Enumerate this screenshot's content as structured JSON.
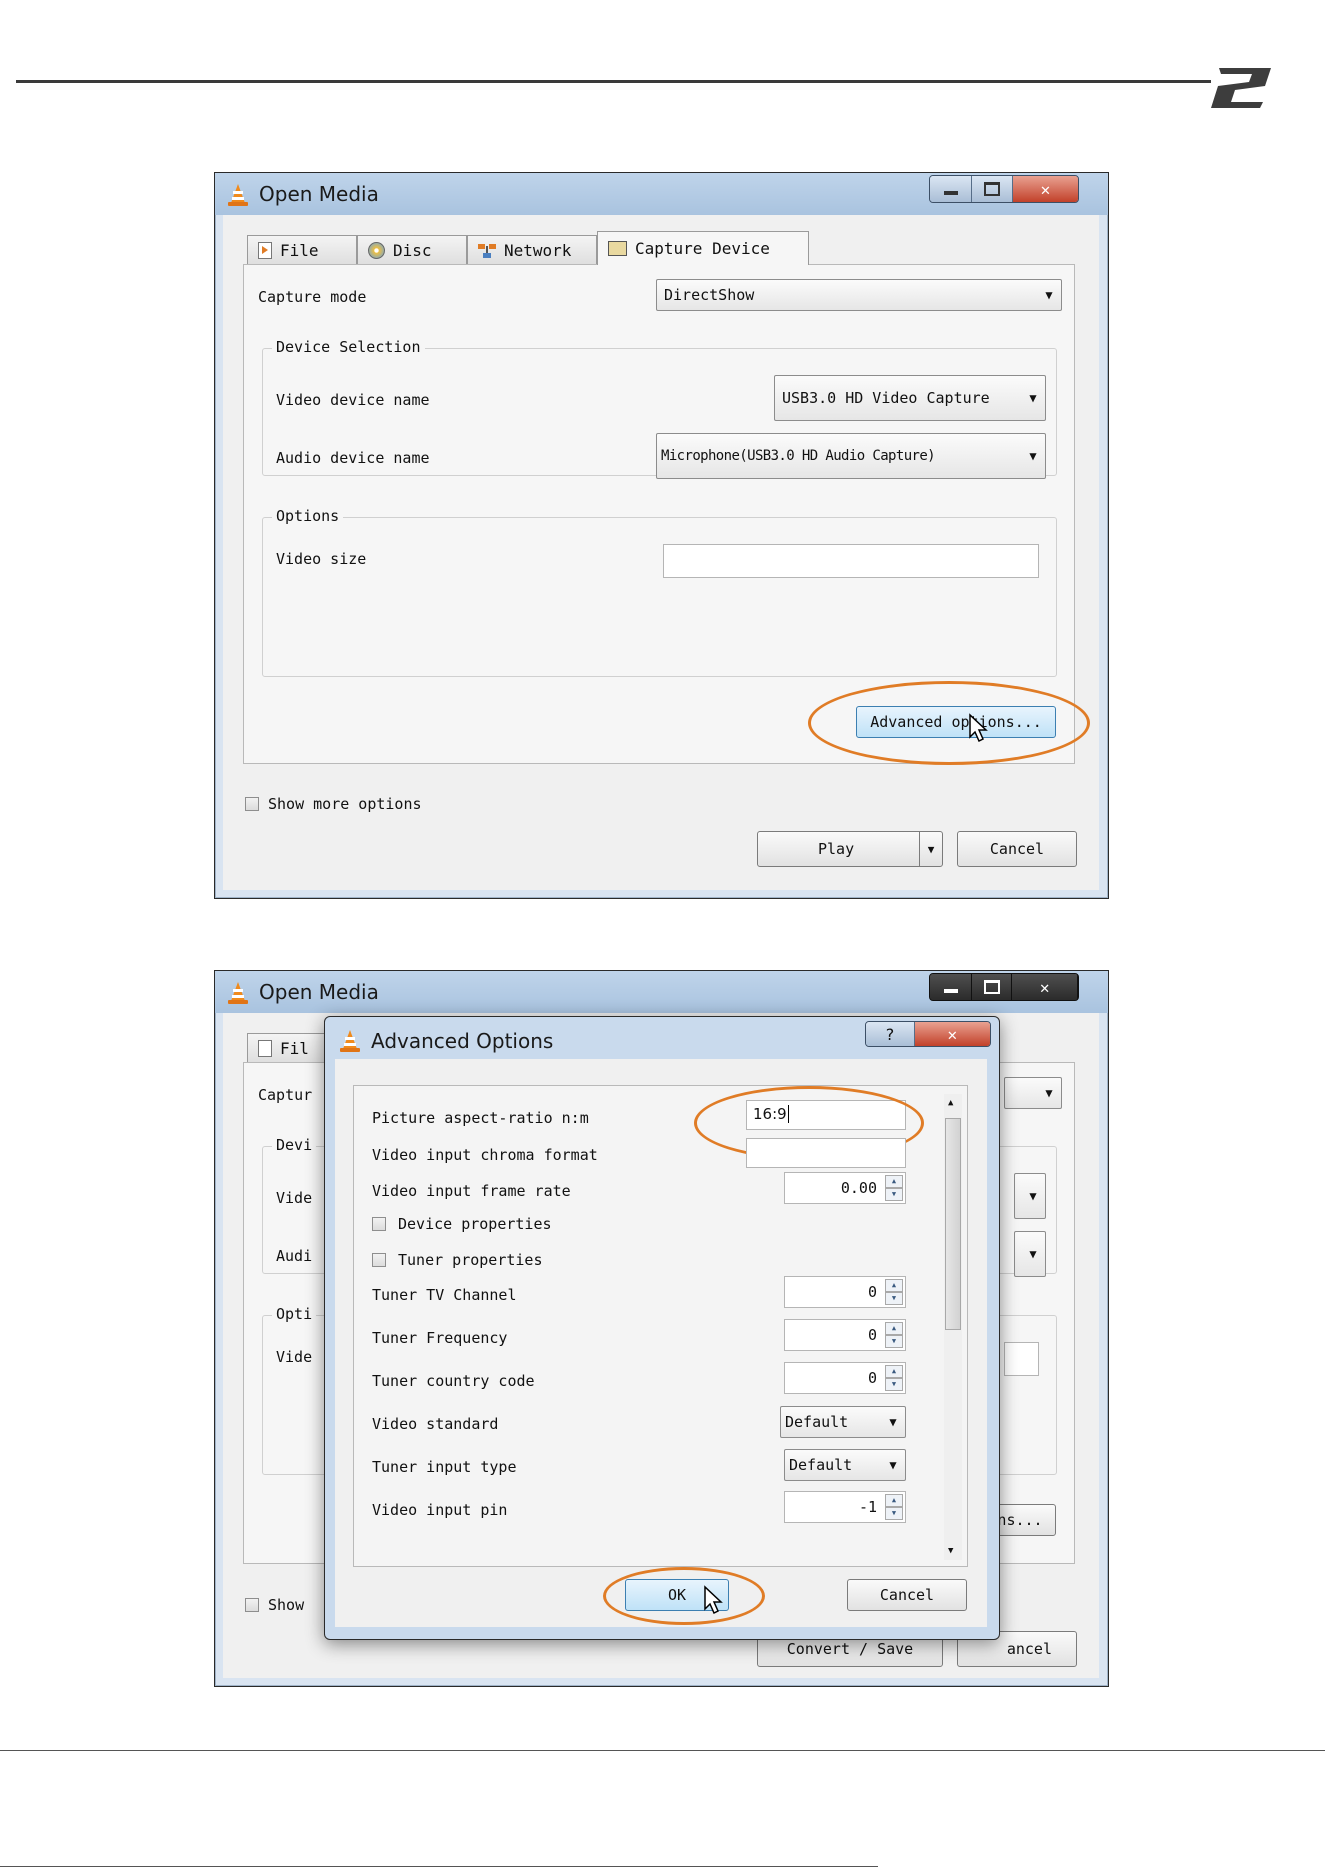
{
  "colors": {
    "highlight": "#e07c26",
    "titlebar": "#bfd4ea",
    "close": "#c2412a"
  },
  "icons": [
    "vlc-cone-icon",
    "file-icon",
    "disc-icon",
    "network-icon",
    "capture-device-icon",
    "minimize-icon",
    "maximize-icon",
    "close-icon",
    "help-icon",
    "cursor-icon",
    "dropdown-arrow-icon",
    "spin-up-icon",
    "spin-down-icon",
    "logo-icon"
  ],
  "open_media": {
    "title": "Open Media",
    "tabs": [
      "File",
      "Disc",
      "Network",
      "Capture Device"
    ],
    "capture_mode_label": "Capture mode",
    "capture_mode_value": "DirectShow",
    "device_selection_title": "Device Selection",
    "video_device_label": "Video device name",
    "video_device_value": "USB3.0 HD Video Capture",
    "audio_device_label": "Audio device name",
    "audio_device_value": "Microphone(USB3.0 HD Audio Capture)",
    "options_title": "Options",
    "video_size_label": "Video size",
    "video_size_value": "",
    "advanced_button": "Advanced options...",
    "show_more_label": "Show more options",
    "play_button": "Play",
    "cancel_button": "Cancel"
  },
  "open_media_bg": {
    "title": "Open Media",
    "tab_partial": "Fil",
    "capture_partial": "Captur",
    "device_partial": "Devi",
    "video_partial": "Vide",
    "audio_partial": "Audi",
    "options_partial": "Opti",
    "video_size_partial": "Vide",
    "advanced_partial": "ns...",
    "show_partial": "Show",
    "convert_button": "Convert / Save",
    "cancel_partial": "ancel"
  },
  "advanced": {
    "title": "Advanced Options",
    "rows": [
      {
        "label": "Picture aspect-ratio n:m",
        "value": "16:9"
      },
      {
        "label": "Video input chroma format",
        "value": ""
      },
      {
        "label": "Video input frame rate",
        "value": "0.00"
      },
      {
        "label": "Device properties"
      },
      {
        "label": "Tuner properties"
      },
      {
        "label": "Tuner TV Channel",
        "value": "0"
      },
      {
        "label": "Tuner Frequency",
        "value": "0"
      },
      {
        "label": "Tuner country code",
        "value": "0"
      },
      {
        "label": "Video standard",
        "value": "Default"
      },
      {
        "label": "Tuner input type",
        "value": "Default"
      },
      {
        "label": "Video input pin",
        "value": "-1"
      }
    ],
    "ok_button": "OK",
    "cancel_button": "Cancel"
  }
}
